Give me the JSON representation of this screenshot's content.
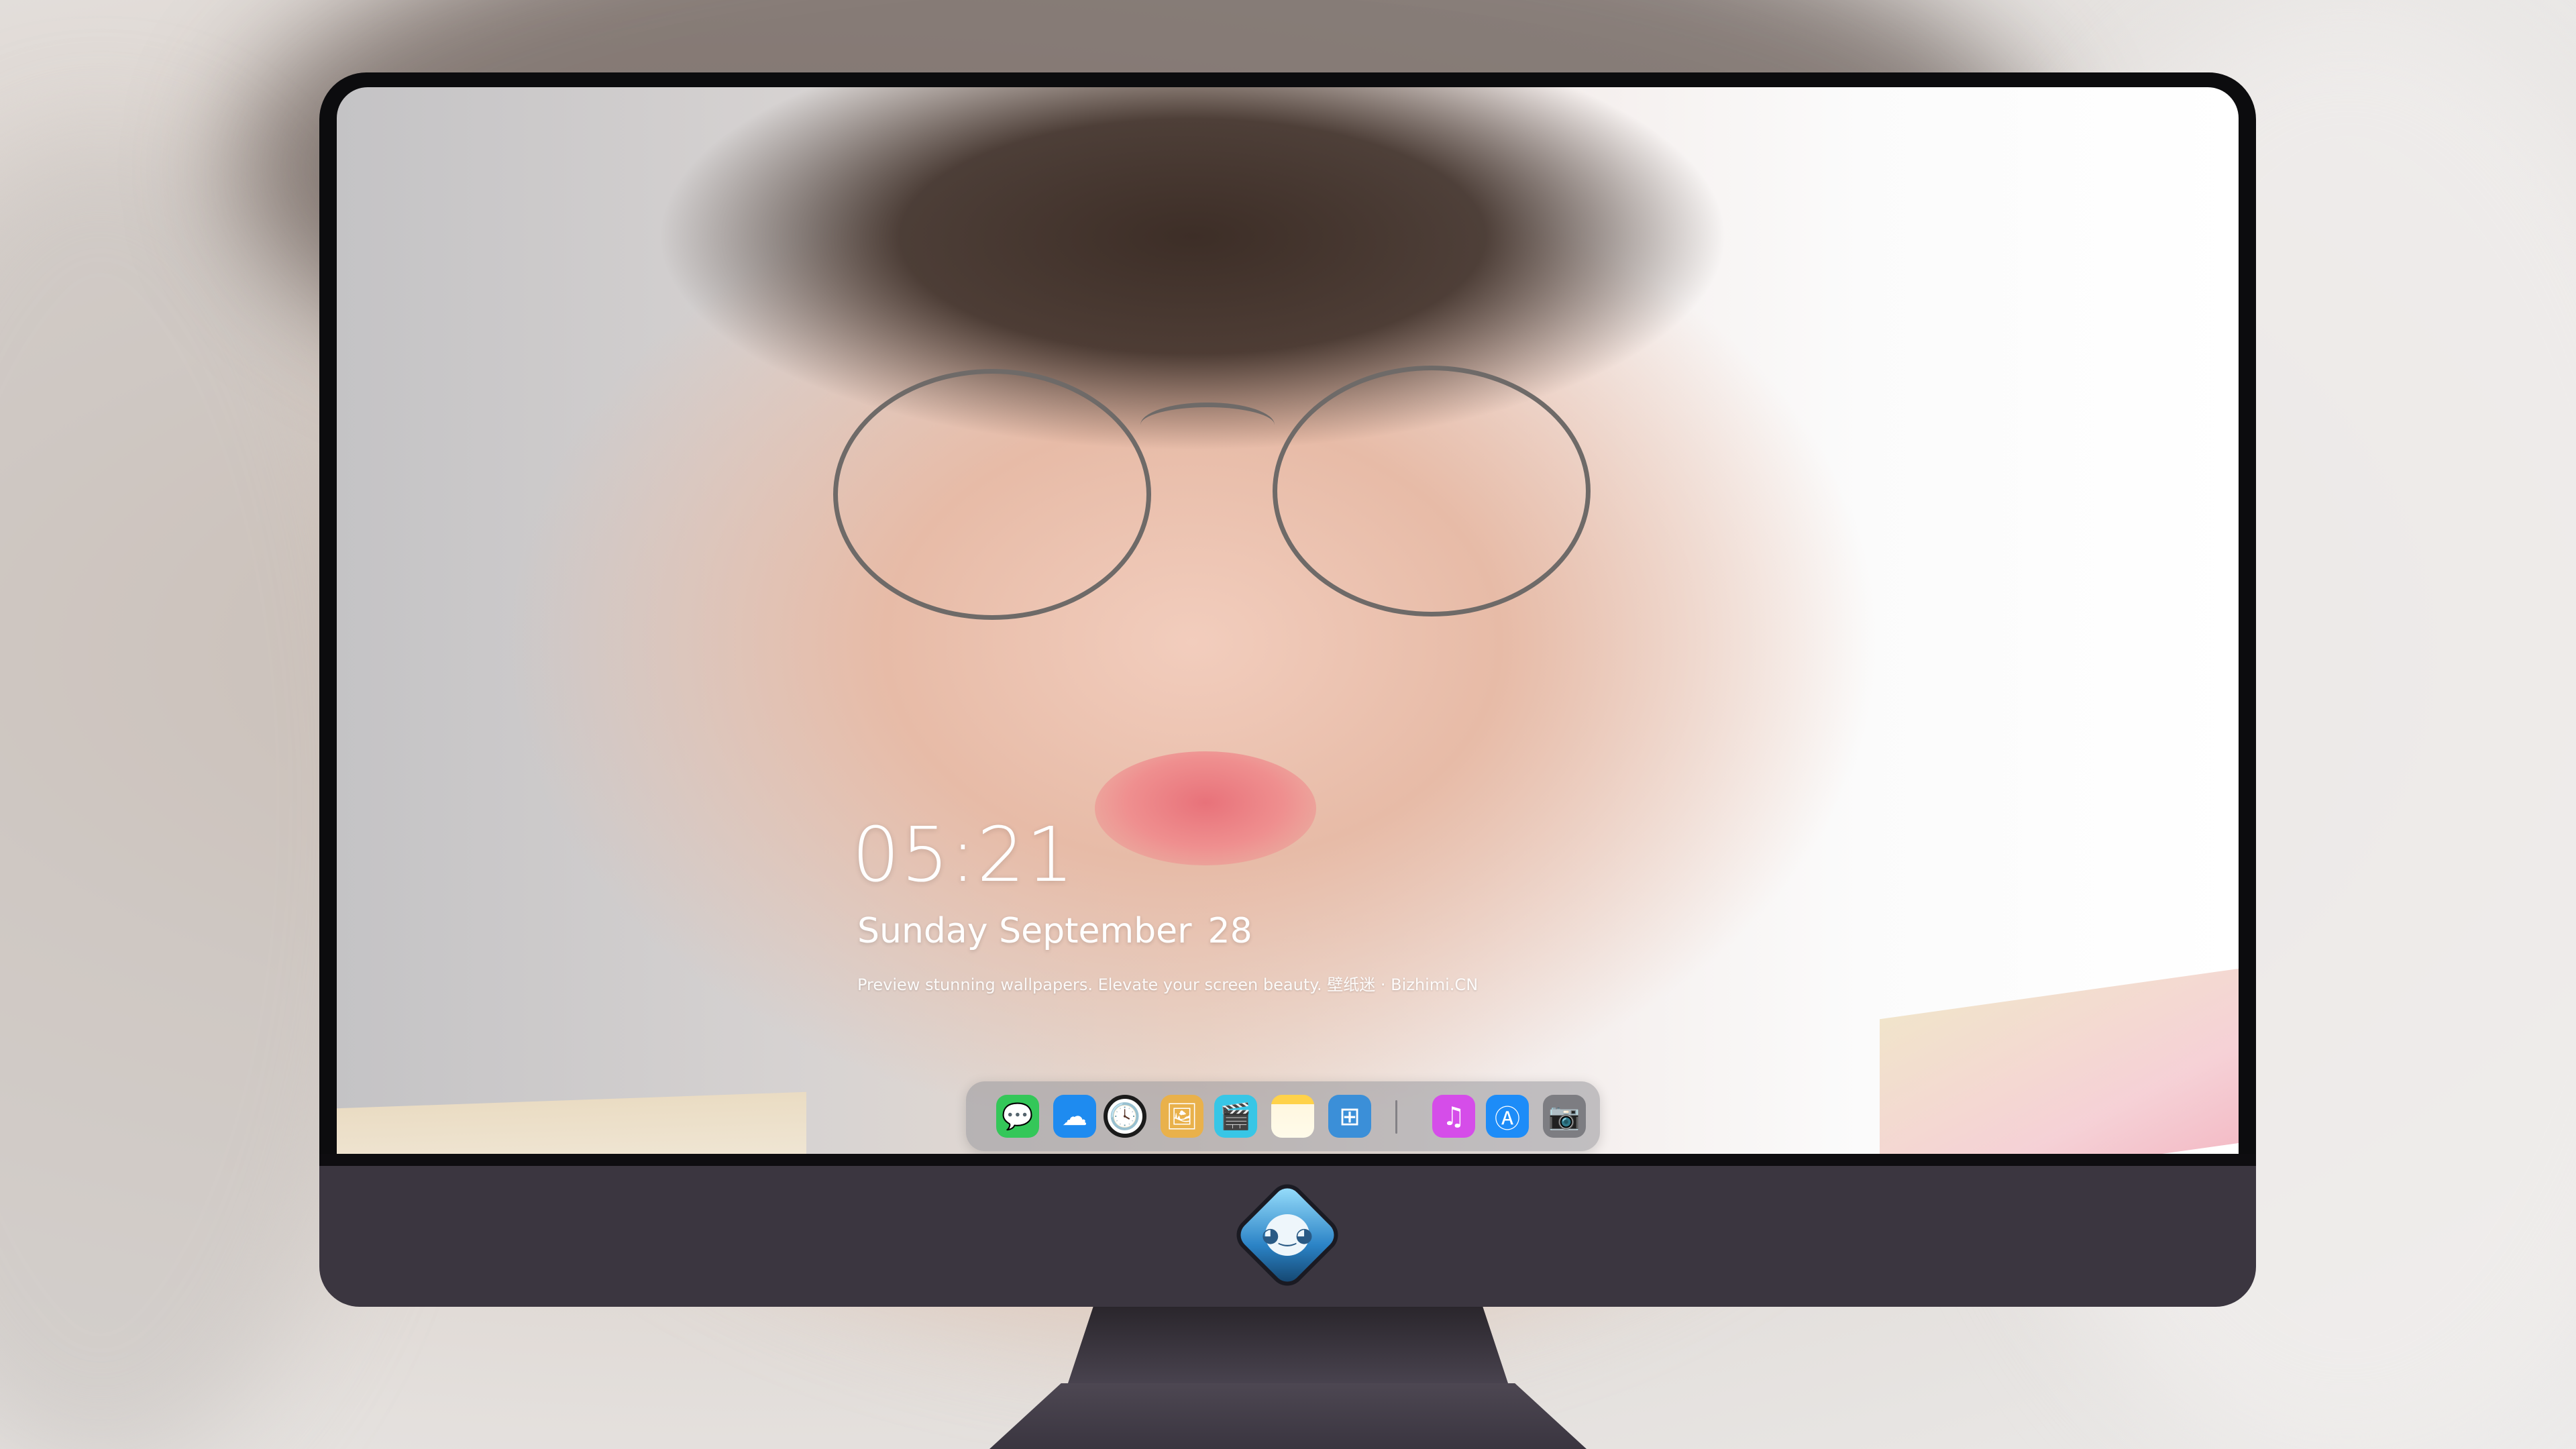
{
  "lockscreen": {
    "time": "05:21",
    "weekday_month": "Sunday September",
    "day": "28",
    "tagline": "Preview stunning wallpapers. Elevate your screen beauty. 壁纸迷 · Bizhimi.CN"
  },
  "dock": {
    "apps": [
      {
        "name": "messages",
        "icon": "speech-bubble-icon",
        "color": "#34c759",
        "glyph": "💬"
      },
      {
        "name": "weather",
        "icon": "cloud-icon",
        "color": "#1e8bf0",
        "glyph": "☁"
      },
      {
        "name": "clock",
        "icon": "clock-icon",
        "color": "#1b1b1b",
        "glyph": "🕓"
      },
      {
        "name": "preview",
        "icon": "preview-icon",
        "color": "#e9b14b",
        "glyph": "🖼"
      },
      {
        "name": "videos",
        "icon": "clapperboard-icon",
        "color": "#37c6e6",
        "glyph": "🎬"
      },
      {
        "name": "notes",
        "icon": "notes-icon",
        "color": "#ffd24a",
        "glyph": "▤"
      },
      {
        "name": "photo-browser",
        "icon": "photos-icon",
        "color": "#3b8fd8",
        "glyph": "⊞"
      },
      {
        "name": "music",
        "icon": "music-note-icon",
        "color": "#d54de9",
        "glyph": "♫"
      },
      {
        "name": "app-store",
        "icon": "app-store-icon",
        "color": "#1d8cf8",
        "glyph": "Ⓐ"
      },
      {
        "name": "camera",
        "icon": "camera-icon",
        "color": "#7d7d82",
        "glyph": "📷"
      }
    ]
  },
  "colors": {
    "dock_bg": "#96969b",
    "bezel": "#0c0c0e",
    "chin": "#3b3640",
    "text": "#ffffff"
  }
}
